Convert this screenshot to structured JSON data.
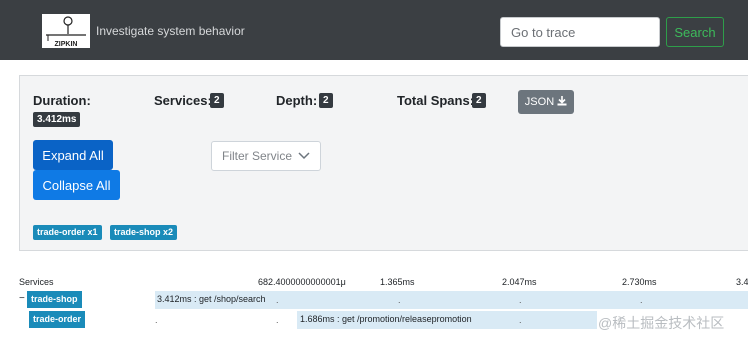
{
  "header": {
    "logo_text": "ZIPKIN",
    "tagline": "Investigate system behavior",
    "search_placeholder": "Go to trace",
    "search_button": "Search"
  },
  "summary": {
    "duration_label": "Duration:",
    "duration_value": "3.412ms",
    "services_label": "Services:",
    "services_value": "2",
    "depth_label": "Depth:",
    "depth_value": "2",
    "spans_label": "Total Spans:",
    "spans_value": "2",
    "json_button": "JSON"
  },
  "controls": {
    "expand_all": "Expand All",
    "collapse_all": "Collapse All",
    "filter_placeholder": "Filter Service"
  },
  "service_chips": [
    "trade-order x1",
    "trade-shop x2"
  ],
  "timeline": {
    "services_header": "Services",
    "ticks": [
      "682.4000000000001μ",
      "1.365ms",
      "2.047ms",
      "2.730ms",
      "3.4"
    ]
  },
  "spans": [
    {
      "toggle": "−",
      "service": "trade-shop",
      "text": "3.412ms : get /shop/search"
    },
    {
      "toggle": "",
      "service": "trade-order",
      "text": "1.686ms : get /promotion/releasepromotion"
    }
  ],
  "watermark": "@稀土掘金技术社区",
  "colors": {
    "navbar": "#3b3f43",
    "primary": "#0f7ae5",
    "service": "#1a8bb9",
    "search_green": "#3dbb5b"
  }
}
